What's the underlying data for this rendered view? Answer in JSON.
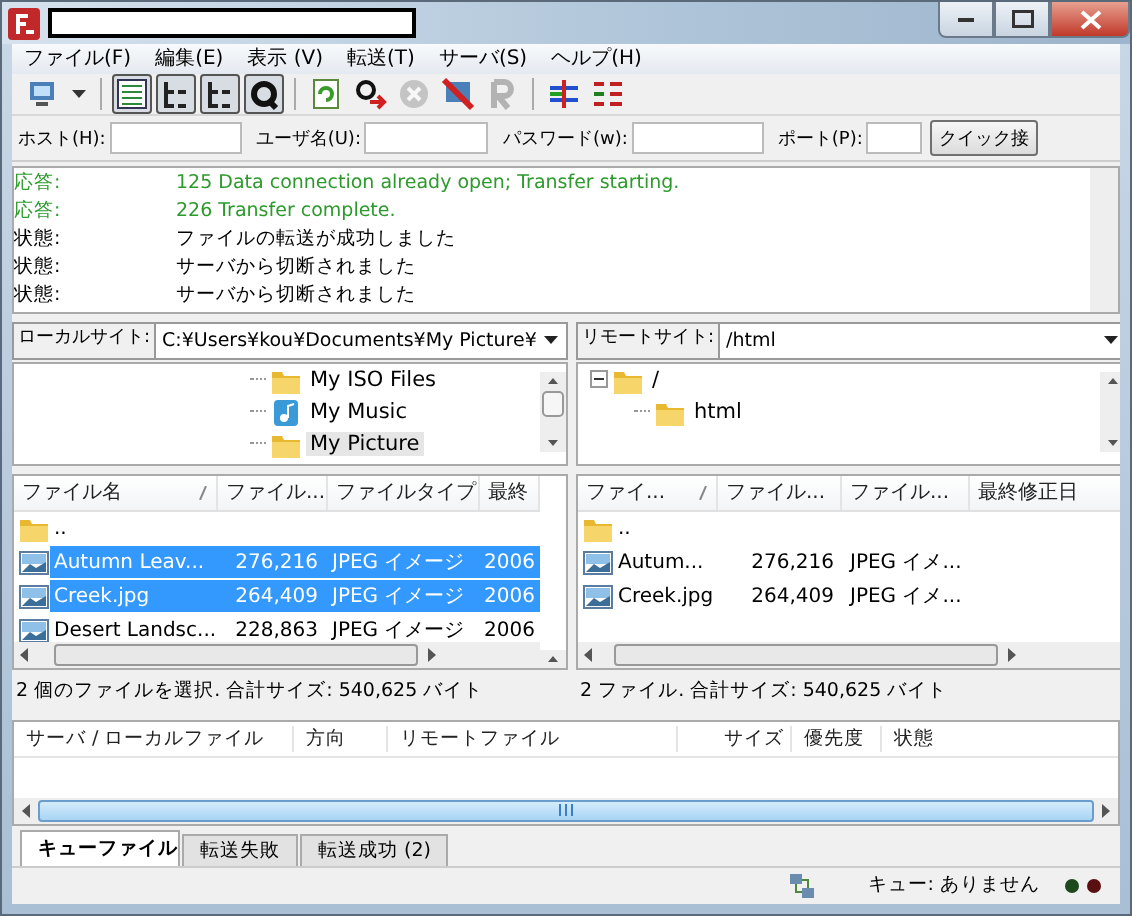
{
  "window": {
    "title_redacted": true
  },
  "menu": [
    "ファイル(F)",
    "編集(E)",
    "表示 (V)",
    "転送(T)",
    "サーバ(S)",
    "ヘルプ(H)"
  ],
  "toolbar": [
    {
      "kind": "site-manager",
      "pressed": false,
      "disabled": false
    },
    {
      "kind": "log",
      "pressed": true,
      "disabled": false
    },
    {
      "kind": "local-tree",
      "pressed": true,
      "disabled": false
    },
    {
      "kind": "remote-tree",
      "pressed": true,
      "disabled": false
    },
    {
      "kind": "queue",
      "pressed": true,
      "disabled": false
    },
    {
      "kind": "refresh",
      "pressed": false,
      "disabled": false
    },
    {
      "kind": "process-queue",
      "pressed": false,
      "disabled": false
    },
    {
      "kind": "cancel",
      "pressed": false,
      "disabled": true
    },
    {
      "kind": "disconnect",
      "pressed": false,
      "disabled": false
    },
    {
      "kind": "reconnect",
      "pressed": false,
      "disabled": true
    },
    {
      "kind": "compare",
      "pressed": false,
      "disabled": false
    },
    {
      "kind": "filter",
      "pressed": false,
      "disabled": false
    }
  ],
  "quickconnect": {
    "fields": [
      {
        "label": "ホスト(H):"
      },
      {
        "label": "ユーザ名(U):"
      },
      {
        "label": "パスワード(w):"
      },
      {
        "label": "ポート(P):"
      }
    ],
    "button": "クイック接"
  },
  "log": [
    {
      "kind": "response",
      "prefix": "応答:",
      "text": "125 Data connection already open; Transfer starting."
    },
    {
      "kind": "response",
      "prefix": "応答:",
      "text": "226 Transfer complete."
    },
    {
      "kind": "status",
      "prefix": "状態:",
      "text": "ファイルの転送が成功しました"
    },
    {
      "kind": "status",
      "prefix": "状態:",
      "text": "サーバから切断されました"
    },
    {
      "kind": "status",
      "prefix": "状態:",
      "text": "サーバから切断されました"
    }
  ],
  "local": {
    "label": "ローカルサイト:",
    "path": "C:¥Users¥kou¥Documents¥My Picture¥",
    "tree": [
      {
        "name": "My ISO Files",
        "kind": "folder",
        "selected": false
      },
      {
        "name": "My Music",
        "kind": "music",
        "selected": false
      },
      {
        "name": "My Picture",
        "kind": "folder",
        "selected": true
      }
    ],
    "columns": [
      "ファイル名",
      "ファイル...",
      "ファイルタイプ",
      "最終"
    ],
    "rows": [
      {
        "kind": "folder",
        "cells": [
          ".."
        ],
        "selected": false
      },
      {
        "kind": "image",
        "cells": [
          "Autumn Leav...",
          "276,216",
          "JPEG イメージ",
          "2006"
        ],
        "selected": true
      },
      {
        "kind": "image",
        "cells": [
          "Creek.jpg",
          "264,409",
          "JPEG イメージ",
          "2006"
        ],
        "selected": true
      },
      {
        "kind": "image",
        "cells": [
          "Desert Landsc...",
          "228,863",
          "JPEG イメージ",
          "2006"
        ],
        "selected": false
      }
    ],
    "status": "2 個のファイルを選択. 合計サイズ: 540,625 バイト"
  },
  "remote": {
    "label": "リモートサイト:",
    "path": "/html",
    "tree": [
      {
        "name": "/",
        "kind": "folder",
        "selected": false,
        "expanded": true,
        "children": [
          {
            "name": "html",
            "kind": "folder",
            "selected": false
          }
        ]
      }
    ],
    "columns": [
      "ファイ...",
      "ファイル...",
      "ファイル...",
      "最終修正日"
    ],
    "rows": [
      {
        "kind": "folder",
        "cells": [
          ".."
        ],
        "selected": false
      },
      {
        "kind": "image",
        "cells": [
          "Autum...",
          "276,216",
          "JPEG イメ..."
        ],
        "selected": false
      },
      {
        "kind": "image",
        "cells": [
          "Creek.jpg",
          "264,409",
          "JPEG イメ..."
        ],
        "selected": false
      }
    ],
    "status": "2 ファイル. 合計サイズ: 540,625 バイト"
  },
  "queue": {
    "columns": [
      "サーバ / ローカルファイル",
      "方向",
      "リモートファイル",
      "サイズ",
      "優先度",
      "状態"
    ],
    "tabs": [
      {
        "label": "キューファイル",
        "selected": true
      },
      {
        "label": "転送失敗",
        "selected": false
      },
      {
        "label": "転送成功 (2)",
        "selected": false
      }
    ]
  },
  "status_bar": {
    "queue": "キュー: ありません"
  }
}
